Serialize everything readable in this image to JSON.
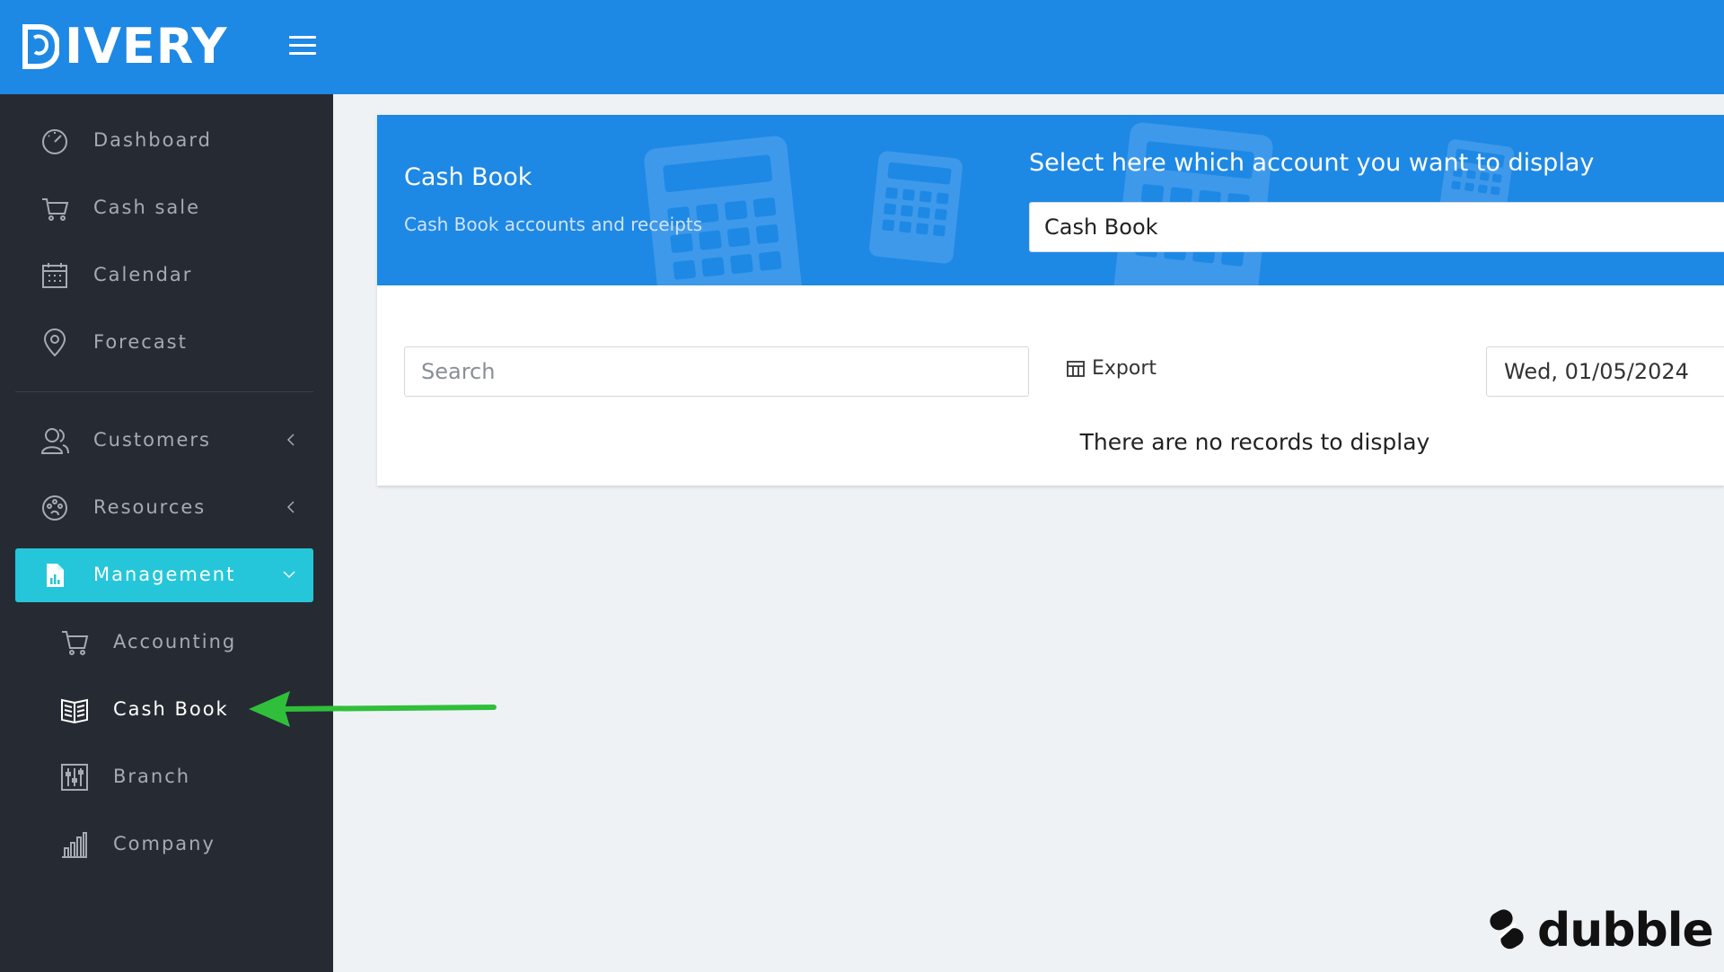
{
  "brand": {
    "name": "IVERY"
  },
  "sidebar": {
    "items": [
      {
        "label": "Dashboard",
        "icon": "gauge-icon"
      },
      {
        "label": "Cash sale",
        "icon": "cart-icon"
      },
      {
        "label": "Calendar",
        "icon": "calendar-icon"
      },
      {
        "label": "Forecast",
        "icon": "map-pin-icon"
      },
      {
        "label": "Customers",
        "icon": "users-icon"
      },
      {
        "label": "Resources",
        "icon": "palette-icon"
      },
      {
        "label": "Management",
        "icon": "report-file-icon"
      }
    ],
    "sub_items": [
      {
        "label": "Accounting",
        "icon": "cart-outline-icon"
      },
      {
        "label": "Cash Book",
        "icon": "book-icon"
      },
      {
        "label": "Branch",
        "icon": "sliders-icon"
      },
      {
        "label": "Company",
        "icon": "bar-chart-icon"
      }
    ]
  },
  "card": {
    "title": "Cash Book",
    "subtitle": "Cash Book accounts and receipts",
    "select_label": "Select here which account you want to display",
    "selected_account": "Cash Book",
    "search_placeholder": "Search",
    "export_label": "Export",
    "date_value": "Wed, 01/05/2024",
    "empty_message": "There are no records to display"
  },
  "watermark": {
    "text": "dubble"
  },
  "colors": {
    "topbar": "#1e88e5",
    "sidebar": "#262b33",
    "active_item": "#26c6da",
    "arrow": "#2fbf3a"
  }
}
